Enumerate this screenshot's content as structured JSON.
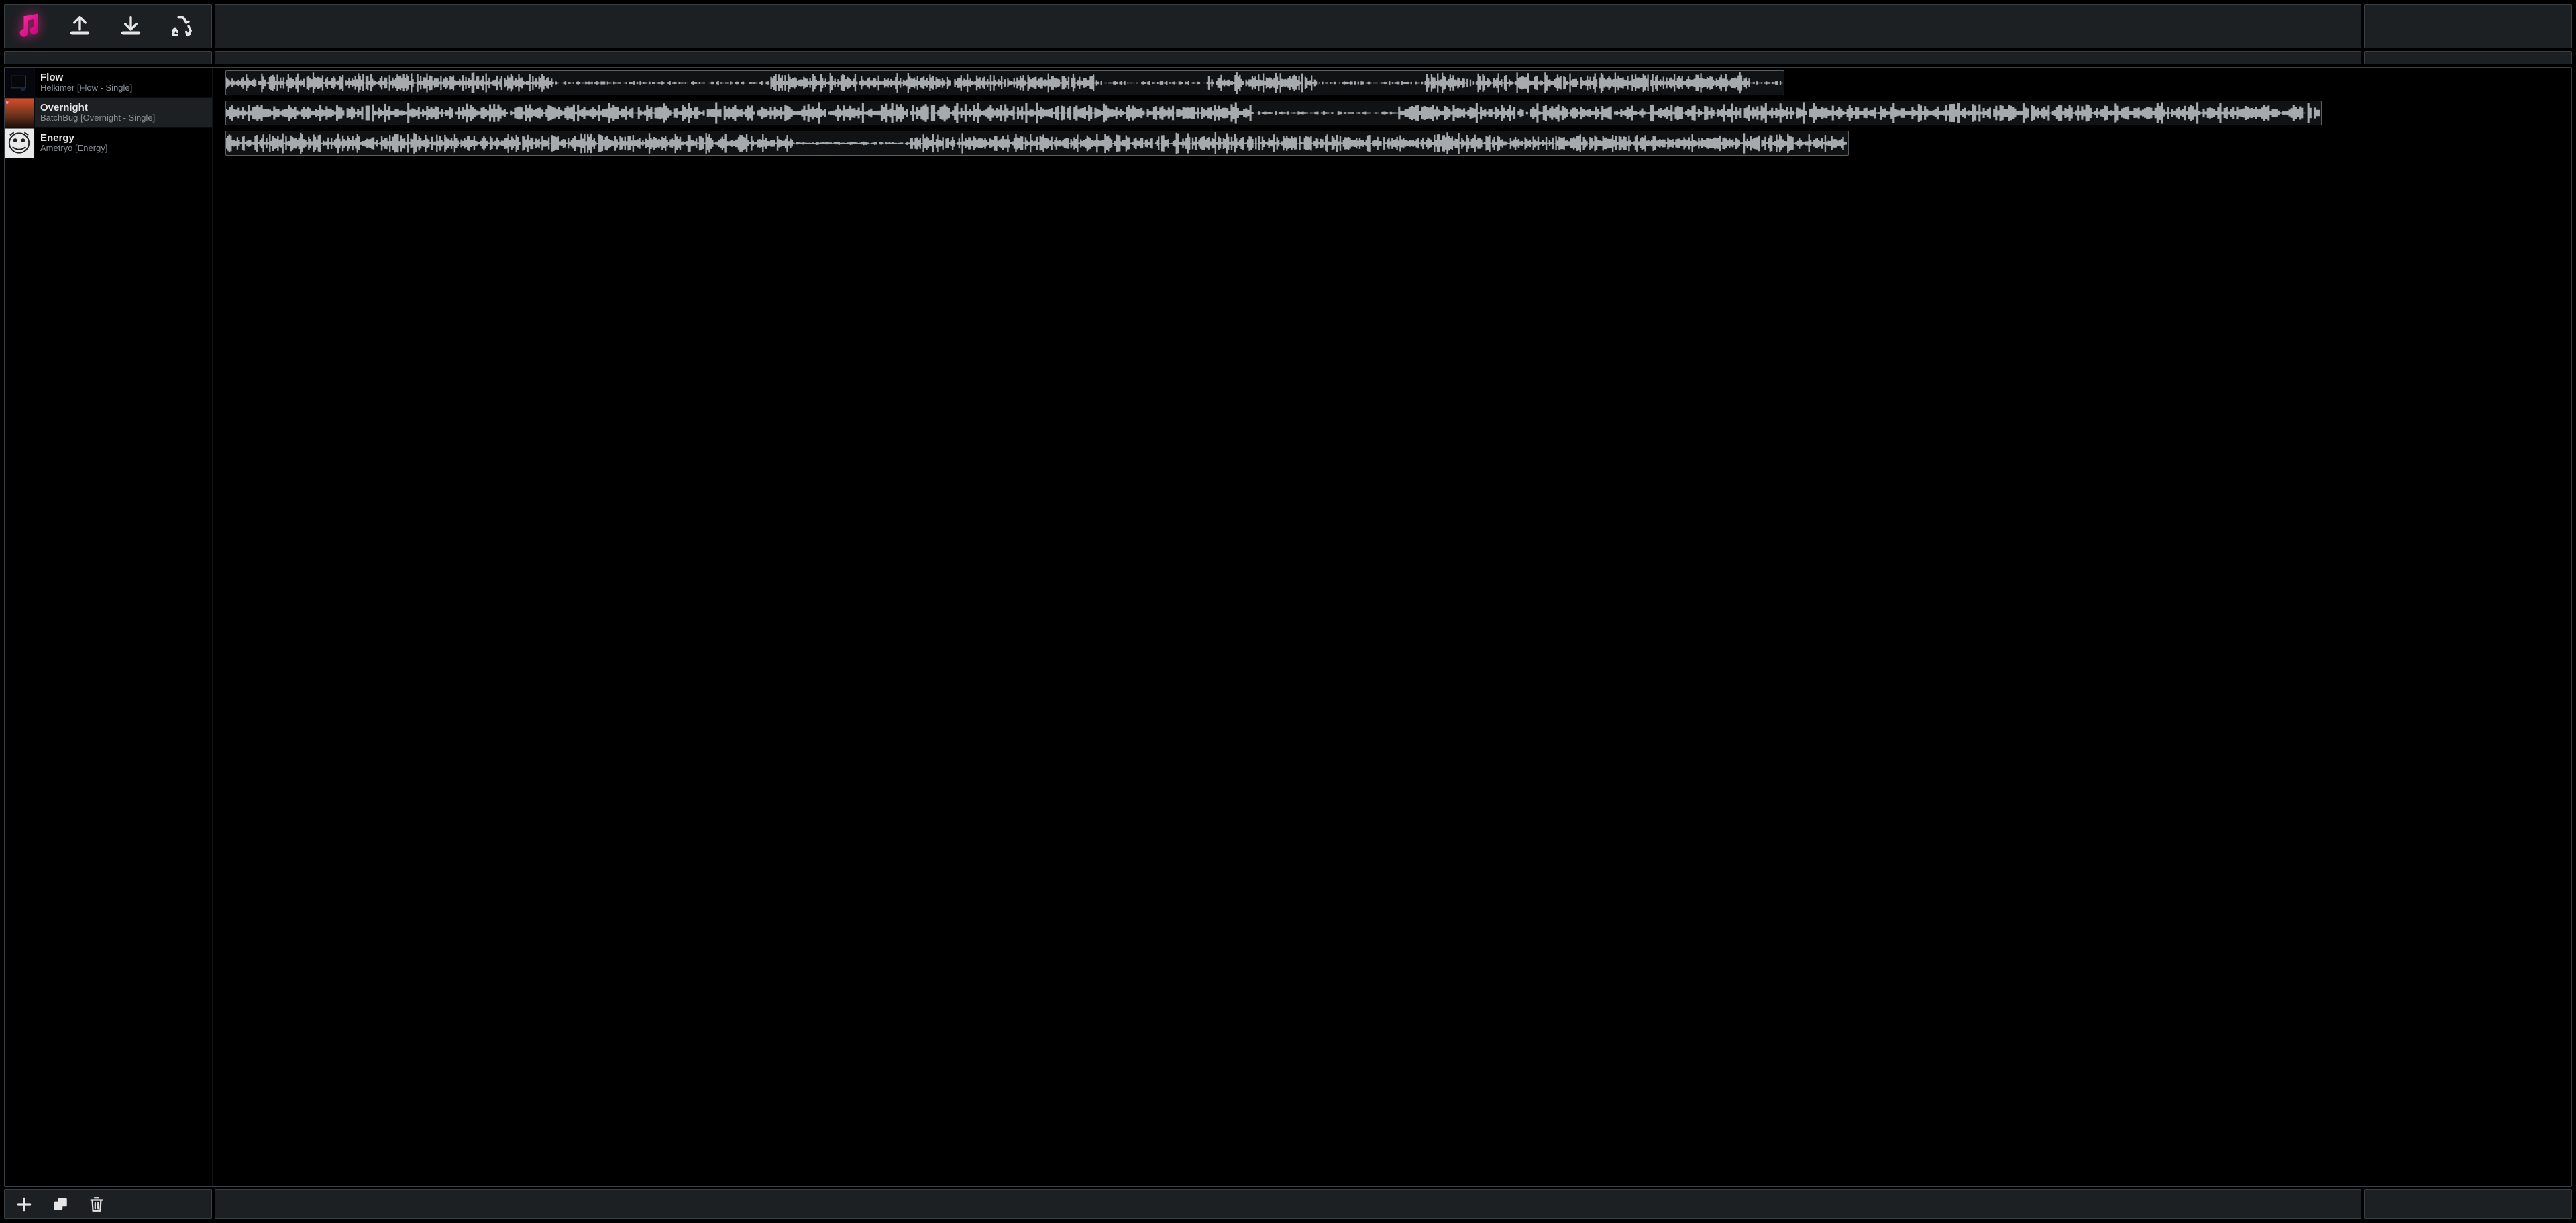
{
  "toolbar_top": {
    "app_icon": "music-note-icon",
    "upload_icon": "upload-icon",
    "download_icon": "download-icon",
    "recycle_icon": "recycle-icon"
  },
  "tracks": [
    {
      "title": "Flow",
      "subtitle": "Helkimer [Flow - Single]",
      "selected": false,
      "clip_start_pct": 0.6,
      "clip_width_pct": 72.5,
      "thumb": "dark-square"
    },
    {
      "title": "Overnight",
      "subtitle": "BatchBug [Overnight - Single]",
      "selected": true,
      "clip_start_pct": 0.6,
      "clip_width_pct": 97.5,
      "thumb": "sunset"
    },
    {
      "title": "Energy",
      "subtitle": "Ametryo [Energy]",
      "selected": false,
      "clip_start_pct": 0.6,
      "clip_width_pct": 75.5,
      "thumb": "tiger"
    }
  ],
  "toolbar_bottom": {
    "add_icon": "plus-icon",
    "layers_icon": "layers-icon",
    "delete_icon": "trash-icon"
  }
}
